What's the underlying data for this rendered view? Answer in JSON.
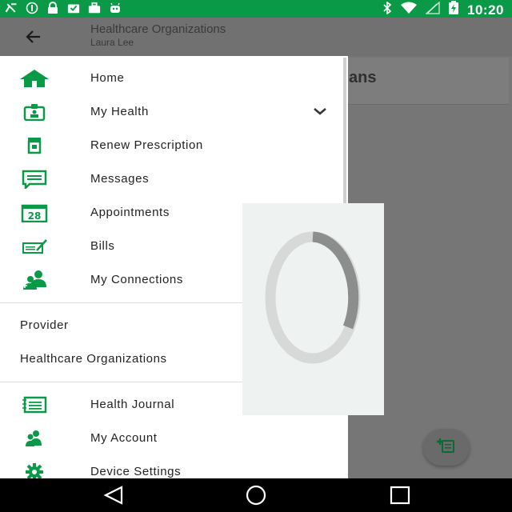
{
  "status_bar": {
    "time": "10:20",
    "left_icons": [
      "carrier-x-icon",
      "nfc-icon",
      "lock-icon",
      "inbox-icon",
      "briefcase-icon",
      "android-icon"
    ],
    "right_icons": [
      "bluetooth-icon",
      "wifi-icon",
      "signal-icon",
      "battery-charging-icon"
    ]
  },
  "app_bar": {
    "title": "Healthcare Organizations",
    "subtitle": "Laura Lee"
  },
  "behind_card": {
    "text": "ans"
  },
  "drawer": {
    "items_top": [
      {
        "label": "Home",
        "icon": "home-icon"
      },
      {
        "label": "My Health",
        "icon": "id-badge-icon",
        "expandable": true
      },
      {
        "label": "Renew Prescription",
        "icon": "prescription-icon"
      },
      {
        "label": "Messages",
        "icon": "message-icon"
      },
      {
        "label": "Appointments",
        "icon": "calendar-icon",
        "badge": "28"
      },
      {
        "label": "Bills",
        "icon": "bill-icon"
      },
      {
        "label": "My Connections",
        "icon": "connections-icon"
      }
    ],
    "items_middle": [
      {
        "label": "Provider"
      },
      {
        "label": "Healthcare Organizations"
      }
    ],
    "items_bottom": [
      {
        "label": "Health Journal",
        "icon": "journal-icon"
      },
      {
        "label": "My Account",
        "icon": "account-icon"
      },
      {
        "label": "Device Settings",
        "icon": "gear-icon"
      }
    ]
  },
  "colors": {
    "accent": "#0a9a47",
    "status_bar": "#0a9a47",
    "scrim": "#767676",
    "drawer_bg": "#ffffff"
  },
  "loader": {
    "icon": "loading-spinner-icon"
  },
  "fab": {
    "icon": "add-document-icon"
  },
  "nav_bar": {
    "buttons": [
      "back-triangle-icon",
      "home-circle-icon",
      "recents-square-icon"
    ]
  }
}
